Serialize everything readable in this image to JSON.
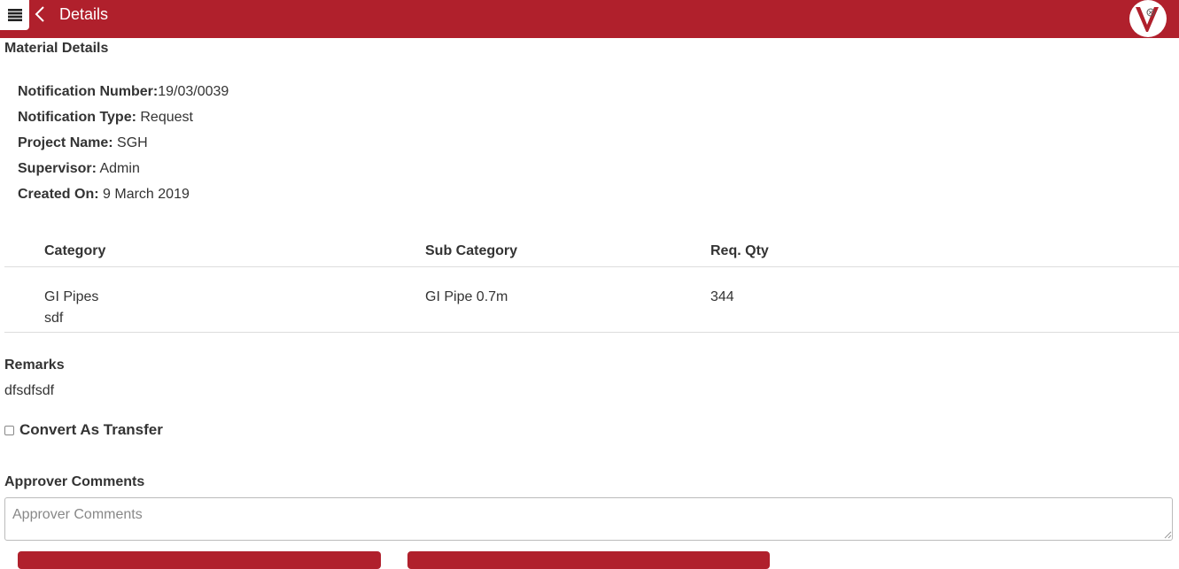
{
  "header": {
    "title": "Details",
    "menu_icon": "hamburger-menu-icon",
    "back_icon": "chevron-left-icon",
    "logo": "v-brand-logo",
    "brand_color": "#b0202c"
  },
  "material_details": {
    "section_title": "Material Details",
    "fields": [
      {
        "label": "Notification Number:",
        "value": "19/03/0039"
      },
      {
        "label": "Notification Type:",
        "value": " Request"
      },
      {
        "label": "Project Name:",
        "value": " SGH"
      },
      {
        "label": "Supervisor:",
        "value": " Admin"
      },
      {
        "label": "Created On:",
        "value": " 9 March 2019"
      }
    ]
  },
  "table": {
    "columns": [
      "Category",
      "Sub Category",
      "Req. Qty"
    ],
    "rows": [
      {
        "category": "GI Pipes",
        "category_note": "sdf",
        "sub_category": "GI Pipe 0.7m",
        "req_qty": "344"
      }
    ]
  },
  "remarks": {
    "title": "Remarks",
    "text": "dfsdfsdf"
  },
  "convert_transfer": {
    "label": "Convert As Transfer",
    "checked": false
  },
  "approver": {
    "title": "Approver Comments",
    "placeholder": "Approver Comments",
    "value": ""
  },
  "actions": {
    "approve_label": "",
    "reject_label": ""
  }
}
